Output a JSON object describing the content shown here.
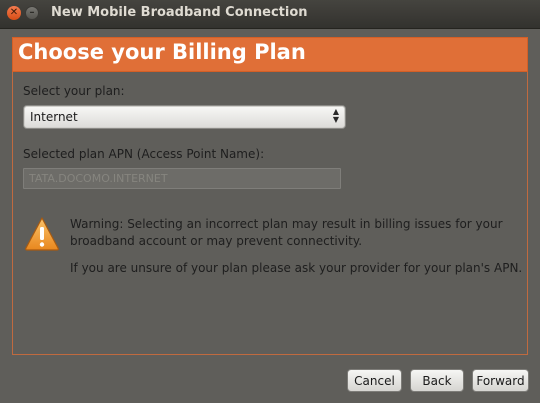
{
  "window": {
    "title": "New Mobile Broadband Connection",
    "close_icon": "close-icon",
    "minimize_icon": "minimize-icon"
  },
  "header": {
    "title": "Choose your Billing Plan",
    "background_color": "#e06f37"
  },
  "plan": {
    "label": "Select your plan:",
    "selected": "Internet"
  },
  "apn": {
    "label": "Selected plan APN (Access Point Name):",
    "value": "TATA.DOCOMO.INTERNET"
  },
  "warning": {
    "icon": "warning-icon",
    "text": "Warning: Selecting an incorrect plan may result in billing issues for your broadband account or may prevent connectivity.",
    "note": "If you are unsure of your plan please ask your provider for your plan's APN."
  },
  "buttons": {
    "cancel": "Cancel",
    "back": "Back",
    "forward": "Forward"
  }
}
